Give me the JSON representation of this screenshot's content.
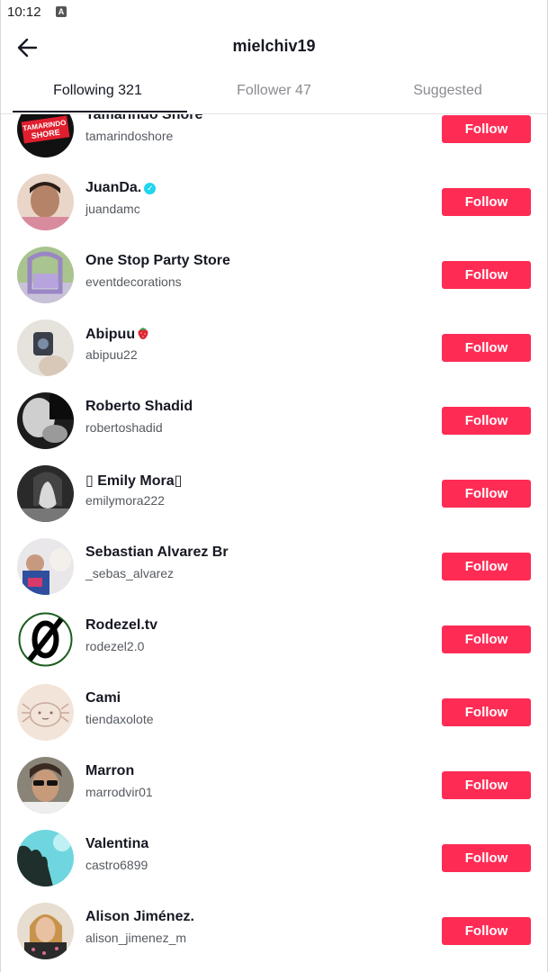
{
  "status_bar": {
    "time": "10:12",
    "notification_icon": "A"
  },
  "header": {
    "back_icon": "arrow-left-icon",
    "title": "mielchiv19"
  },
  "tabs": [
    {
      "label": "Following 321",
      "active": true
    },
    {
      "label": "Follower 47",
      "active": false
    },
    {
      "label": "Suggested",
      "active": false
    }
  ],
  "follow_label": "Follow",
  "users": [
    {
      "name": "Tamarindo Shore",
      "handle": "tamarindoshore",
      "avatar": "tamarindo-logo"
    },
    {
      "name": "JuanDa.",
      "handle": "juandamc",
      "verified": true,
      "avatar": "person-photo"
    },
    {
      "name": "One Stop Party Store",
      "handle": "eventdecorations",
      "avatar": "party-decor-photo"
    },
    {
      "name": "Abipuu",
      "handle": "abipuu22",
      "emoji": "strawberry-icon",
      "avatar": "selfie-photo"
    },
    {
      "name": "Roberto Shadid",
      "handle": "robertoshadid",
      "avatar": "bw-portrait-photo"
    },
    {
      "name": "▯ Emily Mora▯",
      "handle": "emilymora222",
      "avatar": "bw-photo"
    },
    {
      "name": "Sebastian Alvarez Br",
      "handle": "_sebas_alvarez",
      "avatar": "friends-photo"
    },
    {
      "name": "Rodezel.tv",
      "handle": "rodezel2.0",
      "avatar": "slashed-zero-logo"
    },
    {
      "name": "Cami",
      "handle": "tiendaxolote",
      "avatar": "axolotl-drawing"
    },
    {
      "name": "Marron",
      "handle": "marrodvir01",
      "avatar": "sunglasses-photo"
    },
    {
      "name": "Valentina",
      "handle": "castro6899",
      "avatar": "sky-tree-photo"
    },
    {
      "name": "Alison Jiménez.",
      "handle": "alison_jimenez_m",
      "avatar": "portrait-photo"
    }
  ],
  "colors": {
    "follow_button": "#fe2c55",
    "verified_badge": "#20d5ec",
    "text_primary": "#161823",
    "text_secondary": "#555a60",
    "tab_inactive": "#8a8b91"
  }
}
